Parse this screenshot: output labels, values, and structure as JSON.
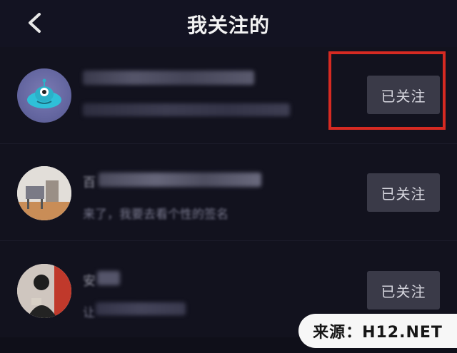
{
  "header": {
    "title": "我关注的",
    "back_icon": "chevron-left-icon"
  },
  "following": [
    {
      "name": "",
      "bio": "",
      "button_label": "已关注"
    },
    {
      "name": "百",
      "bio": "来了，我要去看个性的签名",
      "button_label": "已关注"
    },
    {
      "name": "安",
      "bio": "让",
      "button_label": "已关注"
    }
  ],
  "watermark": {
    "text": "来源：H12.NET"
  },
  "colors": {
    "background": "#0f0f19",
    "header": "#131322",
    "button": "#3a3a48",
    "highlight": "#d62a22"
  }
}
